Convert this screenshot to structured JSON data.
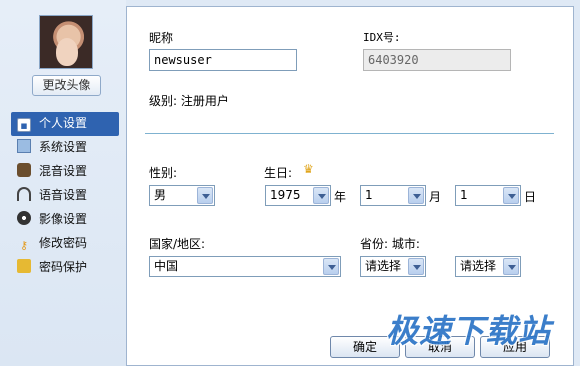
{
  "sidebar": {
    "change_avatar": "更改头像",
    "items": [
      {
        "label": "个人设置",
        "icon": "user-card-icon"
      },
      {
        "label": "系统设置",
        "icon": "system-settings-icon"
      },
      {
        "label": "混音设置",
        "icon": "mixer-icon"
      },
      {
        "label": "语音设置",
        "icon": "headphones-icon"
      },
      {
        "label": "影像设置",
        "icon": "camera-icon"
      },
      {
        "label": "修改密码",
        "icon": "key-icon"
      },
      {
        "label": "密码保护",
        "icon": "lock-icon"
      }
    ]
  },
  "form": {
    "nickname_label": "昵称",
    "nickname_value": "newsuser",
    "idx_label": "IDX号:",
    "idx_value": "6403920",
    "level_text": "级别: 注册用户",
    "gender_label": "性别:",
    "gender_value": "男",
    "birthday_label": "生日:",
    "year_value": "1975",
    "year_unit": "年",
    "month_value": "1",
    "month_unit": "月",
    "day_value": "1",
    "day_unit": "日",
    "country_label": "国家/地区:",
    "country_value": "中国",
    "province_city_label": "省份: 城市:",
    "province_value": "请选择",
    "city_value": "请选择"
  },
  "buttons": {
    "ok": "确定",
    "cancel": "取消",
    "apply": "应用"
  },
  "watermark": "极速下载站",
  "colors": {
    "accent": "#2f63b0",
    "divider": "#7fb2d0",
    "watermark": "#2b74c6"
  }
}
